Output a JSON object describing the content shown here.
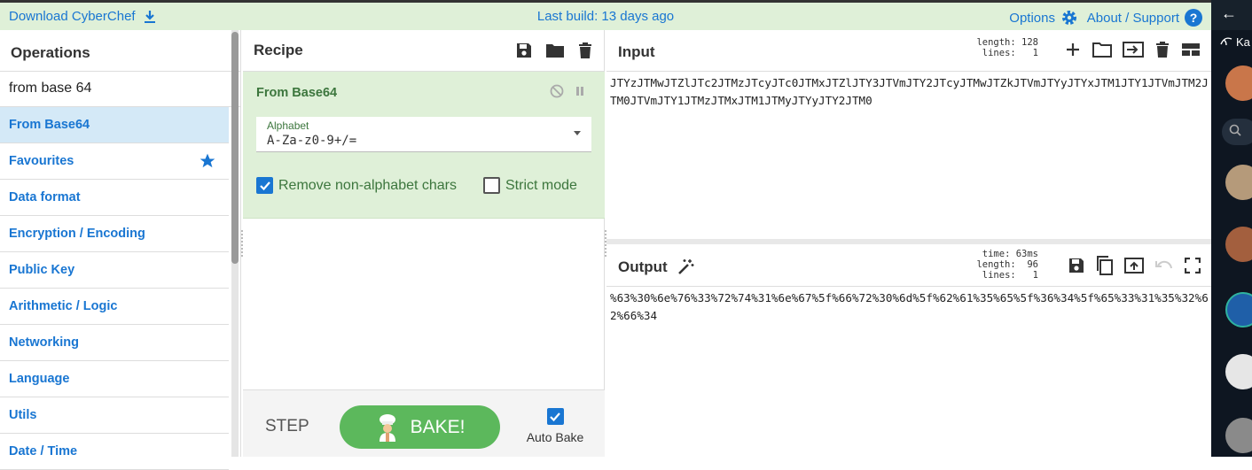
{
  "topbar": {
    "download": "Download CyberChef",
    "build": "Last build: 13 days ago",
    "options": "Options",
    "about": "About / Support",
    "help_glyph": "?"
  },
  "operations": {
    "title": "Operations",
    "search_value": "from base 64",
    "items": [
      {
        "label": "From Base64",
        "selected": true
      },
      {
        "label": "Favourites",
        "icon": "star-icon"
      },
      {
        "label": "Data format"
      },
      {
        "label": "Encryption / Encoding"
      },
      {
        "label": "Public Key"
      },
      {
        "label": "Arithmetic / Logic"
      },
      {
        "label": "Networking"
      },
      {
        "label": "Language"
      },
      {
        "label": "Utils"
      },
      {
        "label": "Date / Time"
      }
    ]
  },
  "recipe": {
    "title": "Recipe",
    "operation": {
      "name": "From Base64",
      "alphabet_label": "Alphabet",
      "alphabet_value": "A-Za-z0-9+/=",
      "remove_non_alpha": "Remove non-alphabet chars",
      "strict_mode": "Strict mode"
    },
    "step": "STEP",
    "bake": "BAKE!",
    "auto_bake": "Auto Bake"
  },
  "input": {
    "title": "Input",
    "length_label": "length: 128",
    "lines_label": "lines:   1",
    "text": "JTYzJTMwJTZlJTc2JTMzJTcyJTc0JTMxJTZlJTY3JTVmJTY2JTcyJTMwJTZkJTVmJTYyJTYxJTM1JTY1JTVmJTM2JTM0JTVmJTY1JTMzJTMxJTM1JTMyJTYyJTY2JTM0"
  },
  "output": {
    "title": "Output",
    "time_label": "time: 63ms",
    "length_label": "length:  96",
    "lines_label": "lines:   1",
    "text": "%63%30%6e%76%33%72%74%31%6e%67%5f%66%72%30%6d%5f%62%61%35%65%5f%36%34%5f%65%33%31%35%32%62%66%34"
  },
  "side": {
    "arrow": "←",
    "ka": "Ka"
  },
  "colors": {
    "accent_blue": "#1976d2",
    "recipe_green": "#dff0d8",
    "bake_green": "#5cb85c"
  }
}
